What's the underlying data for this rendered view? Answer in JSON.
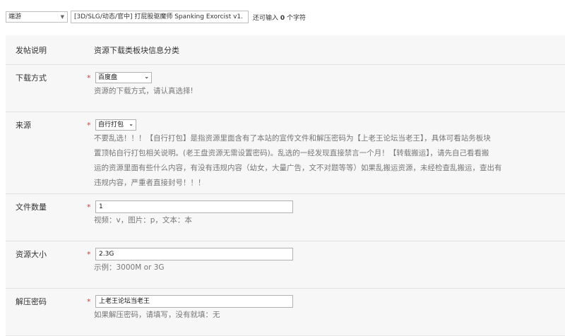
{
  "top": {
    "type_value": "端游",
    "title_value": "[3D/SLG/动态/官中] 打屁股驱魔师 Spanking Exorcist v1.",
    "remaining_prefix": "还可输入",
    "remaining_count": "0",
    "remaining_suffix": "个字符"
  },
  "form": {
    "header": {
      "label": "发帖说明",
      "text": "资源下载类板块信息分类"
    },
    "download": {
      "label": "下载方式",
      "required": "*",
      "selected": "百度盘",
      "hint": "资源的下载方式，请认真选择!"
    },
    "source": {
      "label": "来源",
      "required": "*",
      "selected": "自行打包",
      "hint_lines": [
        "不要乱选！！！【自行打包】是指资源里面含有了本站的宣传文件和解压密码为【上老王论坛当老王】，具体可看站务板块",
        "置顶帖自行打包相关说明。(老王盘资源无需设置密码)。乱选的一经发现直接禁言一个月！【转载搬运】，请先自己看看搬",
        "运的资源里面有些什么内容，有没有违规内容（幼女，大量广告，文不对题等等）如果乱搬运资源，未经检查乱搬运，查出有",
        "违规内容，严重者直接封号！！！"
      ]
    },
    "file_count": {
      "label": "文件数量",
      "required": "*",
      "value": "1",
      "hint": "视频：v，图片：p，文本：本"
    },
    "size": {
      "label": "资源大小",
      "required": "*",
      "value": "2.3G",
      "hint": "示例：3000M or 3G"
    },
    "password": {
      "label": "解压密码",
      "required": "*",
      "value": "上老王论坛当老王",
      "hint": "如果解压密码，请填写，没有就填：无"
    }
  }
}
